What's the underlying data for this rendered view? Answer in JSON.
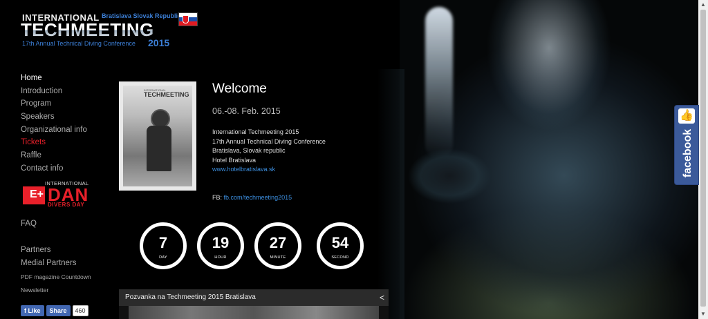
{
  "logo": {
    "international": "INTERNATIONAL",
    "city": "Bratislava Slovak Republic",
    "techmeeting": "TECHMEETING",
    "subtitle": "17th Annual Technical Diving Conference",
    "year": "2015",
    "flag_icon": "slovakia-flag-icon"
  },
  "nav": {
    "items": [
      {
        "label": "Home",
        "state": "active"
      },
      {
        "label": "Introduction"
      },
      {
        "label": "Program"
      },
      {
        "label": "Speakers"
      },
      {
        "label": "Organizational info"
      },
      {
        "label": "Tickets",
        "state": "highlight"
      },
      {
        "label": "Raffle"
      },
      {
        "label": "Contact info"
      }
    ],
    "highlight_color": "#e8202a"
  },
  "dan": {
    "international": "INTERNATIONAL",
    "word": "DAN",
    "divers_day": "DIVERS DAY",
    "cross": "E+"
  },
  "nav_lower": {
    "faq": "FAQ",
    "partners": "Partners",
    "medial_partners": "Medial Partners",
    "pdf": "PDF magazine Countdown",
    "newsletter": "Newsletter"
  },
  "facebook_buttons": {
    "like": "Like",
    "share": "Share",
    "count": "460"
  },
  "poster": {
    "title": "TECHMEETING",
    "small": "INTERNATIONAL"
  },
  "welcome": {
    "title": "Welcome",
    "date": "06.-08. Feb. 2015",
    "lines": [
      "International Techmeeting 2015",
      "17th Annual Technical Diving Conference",
      "Bratislava, Slovak republic",
      "Hotel Bratislava"
    ],
    "hotel_link": "www.hotelbratislava.sk",
    "fb_label": "FB:",
    "fb_link": "fb.com/techmeeting2015"
  },
  "countdown": [
    {
      "value": "7",
      "unit": "DAY"
    },
    {
      "value": "19",
      "unit": "HOUR"
    },
    {
      "value": "27",
      "unit": "MINUTE"
    },
    {
      "value": "54",
      "unit": "SECOND"
    }
  ],
  "video": {
    "title": "Pozvanka na Techmeeting 2015 Bratislava",
    "share_icon": "share-icon"
  },
  "fb_side_tab": {
    "label": "facebook",
    "icon": "thumbs-up-icon"
  },
  "colors": {
    "link_blue": "#3c8fe0",
    "brand_blue": "#3c7fd6",
    "facebook_blue": "#3b5a9a"
  }
}
